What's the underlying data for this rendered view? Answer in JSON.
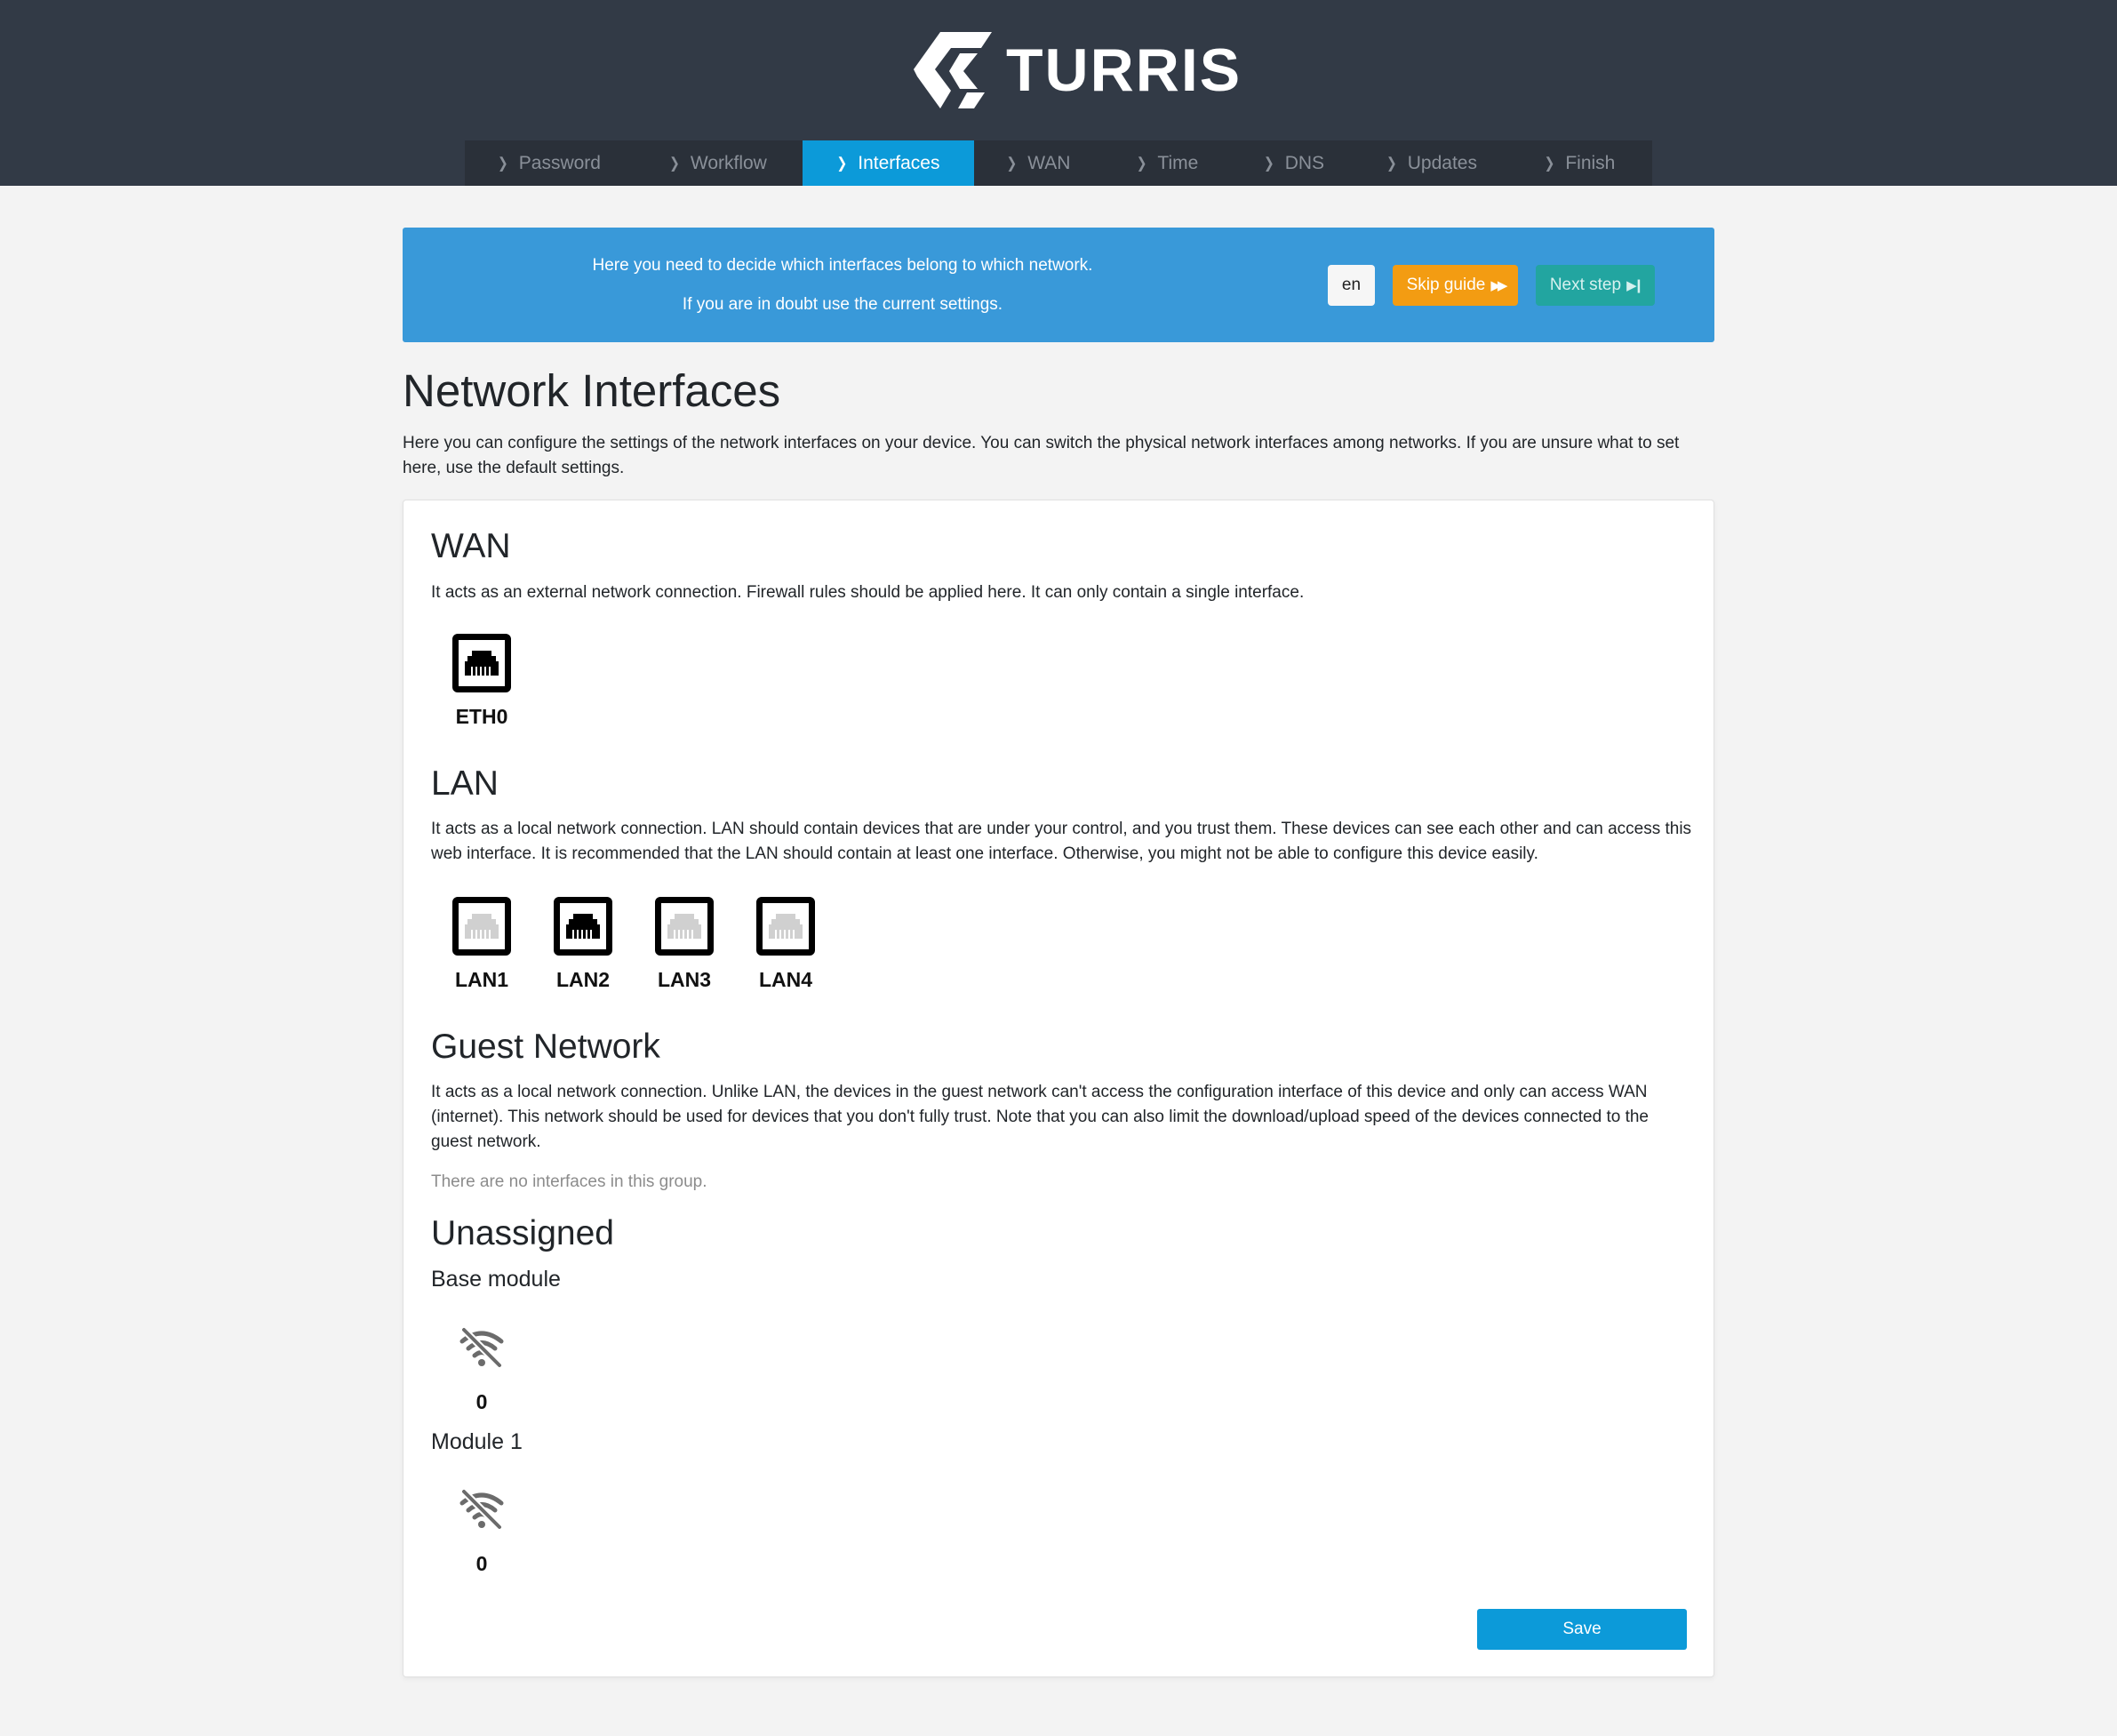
{
  "brand": {
    "name": "TURRIS"
  },
  "nav": {
    "items": [
      {
        "label": "Password"
      },
      {
        "label": "Workflow"
      },
      {
        "label": "Interfaces"
      },
      {
        "label": "WAN"
      },
      {
        "label": "Time"
      },
      {
        "label": "DNS"
      },
      {
        "label": "Updates"
      },
      {
        "label": "Finish"
      }
    ],
    "active": "Interfaces"
  },
  "guide": {
    "line1": "Here you need to decide which interfaces belong to which network.",
    "line2": "If you are in doubt use the current settings.",
    "language": "en",
    "skip_label": "Skip guide",
    "next_label": "Next step"
  },
  "page": {
    "title": "Network Interfaces",
    "description": "Here you can configure the settings of the network interfaces on your device. You can switch the physical network interfaces among networks. If you are unsure what to set here, use the default settings."
  },
  "wan": {
    "title": "WAN",
    "description": "It acts as an external network connection. Firewall rules should be applied here. It can only contain a single interface.",
    "interfaces": [
      {
        "label": "ETH0",
        "state": "connected"
      }
    ]
  },
  "lan": {
    "title": "LAN",
    "description": "It acts as a local network connection. LAN should contain devices that are under your control, and you trust them. These devices can see each other and can access this web interface. It is recommended that the LAN should contain at least one interface. Otherwise, you might not be able to configure this device easily.",
    "interfaces": [
      {
        "label": "LAN1",
        "state": "disconnected"
      },
      {
        "label": "LAN2",
        "state": "connected"
      },
      {
        "label": "LAN3",
        "state": "disconnected"
      },
      {
        "label": "LAN4",
        "state": "disconnected"
      }
    ]
  },
  "guest": {
    "title": "Guest Network",
    "description": "It acts as a local network connection. Unlike LAN, the devices in the guest network can't access the configuration interface of this device and only can access WAN (internet). This network should be used for devices that you don't fully trust. Note that you can also limit the download/upload speed of the devices connected to the guest network.",
    "empty_note": "There are no interfaces in this group."
  },
  "unassigned": {
    "title": "Unassigned",
    "modules": [
      {
        "name": "Base module",
        "interfaces": [
          {
            "label": "0",
            "icon": "wifi-off-icon"
          }
        ]
      },
      {
        "name": "Module 1",
        "interfaces": [
          {
            "label": "0",
            "icon": "wifi-off-icon"
          }
        ]
      }
    ]
  },
  "actions": {
    "save_label": "Save"
  },
  "colors": {
    "header_bg": "#323a46",
    "nav_bg": "#2a3039",
    "nav_active": "#0c9ad9",
    "guide_bg": "#3999d9",
    "skip_button": "#f39c12",
    "next_button": "#22a5a0",
    "save_button": "#0c9ad9",
    "port_connected": "#000000",
    "port_disconnected": "#d0d0d0"
  }
}
